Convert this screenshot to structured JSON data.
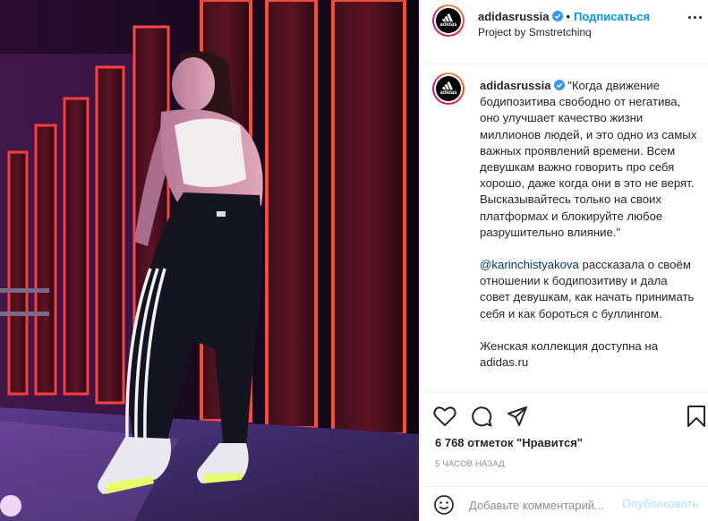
{
  "account": {
    "username": "adidasrussia",
    "verified": true,
    "logo_text": "adidas",
    "follow_label": "Подписаться",
    "subtitle": "Project by Smstretchinq"
  },
  "caption": {
    "username": "adidasrussia",
    "paragraph1": "\"Когда движение бодипозитива свободно от негатива, оно улучшает качество жизни миллионов людей, и это одно из самых важных проявлений времени. Всем девушкам важно говорить про себя хорошо, даже когда они в это не верят. Высказывайтесь только на своих платформах и блокируйте любое разрушительно влияние.\"",
    "mention": "@karinchistyakova",
    "paragraph2": " рассказала о своём отношении к бодипозитиву и дала совет девушкам, как начать принимать себя и как бороться с буллингом.",
    "paragraph3": "Женская коллекция доступна на adidas.ru"
  },
  "actions": {
    "like_icon": "heart-icon",
    "comment_icon": "comment-icon",
    "share_icon": "paper-plane-icon",
    "save_icon": "bookmark-icon"
  },
  "stats": {
    "likes": "6 768 отметок \"Нравится\"",
    "time": "5 часов назад"
  },
  "comment_box": {
    "placeholder": "Добавьте комментарий...",
    "publish_label": "Опубликовать",
    "emoji_icon": "smiley-icon"
  },
  "colors": {
    "accent": "#0095f6",
    "publish_disabled": "#b2dffc",
    "mention": "#00376b",
    "muted": "#8e8e8e",
    "verified": "#3897f0"
  }
}
